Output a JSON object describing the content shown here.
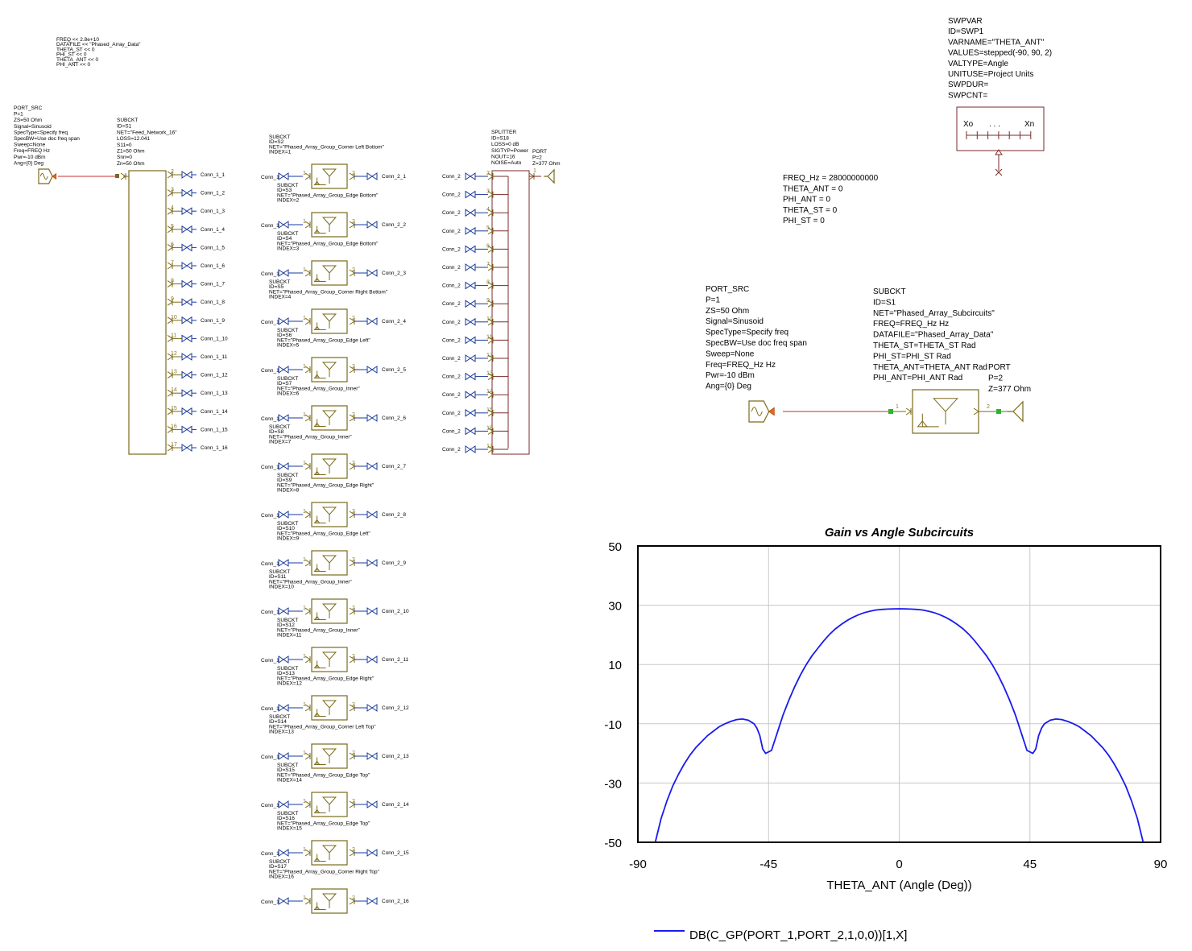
{
  "globals": {
    "lines": [
      "FREQ << 2.8e+10",
      "DATAFILE << \"Phased_Array_Data\"",
      "THETA_ST << 0",
      "PHI_ST << 0",
      "THETA_ANT << 0",
      "PHI_ANT << 0"
    ]
  },
  "port_src_small": {
    "lines": [
      "PORT_SRC",
      "P=1",
      "ZS=50 Ohm",
      "Signal=Sinusoid",
      "SpecType=Specify freq",
      "SpecBW=Use doc freq span",
      "Sweep=None",
      "Freq=FREQ Hz",
      "Pwr=-10 dBm",
      "Ang={0} Deg"
    ]
  },
  "feed_network": {
    "lines": [
      "SUBCKT",
      "ID=S1",
      "NET=\"Feed_Network_16\"",
      "LOSS=12.041",
      "S11=0",
      "Z1=50 Ohm",
      "Snn=0",
      "Zn=50 Ohm"
    ],
    "pins": [
      "2",
      "3",
      "4",
      "5",
      "6",
      "7",
      "8",
      "9",
      "10",
      "11",
      "12",
      "13",
      "14",
      "15",
      "16",
      "17"
    ],
    "conns": [
      "Conn_1_1",
      "Conn_1_2",
      "Conn_1_3",
      "Conn_1_4",
      "Conn_1_5",
      "Conn_1_6",
      "Conn_1_7",
      "Conn_1_8",
      "Conn_1_9",
      "Conn_1_10",
      "Conn_1_11",
      "Conn_1_12",
      "Conn_1_13",
      "Conn_1_14",
      "Conn_1_15",
      "Conn_1_16"
    ]
  },
  "groups": [
    {
      "id": "ID=S2",
      "net": "NET=\"Phased_Array_Group_Corner Left Bottom\"",
      "index": "INDEX=1",
      "in": "Conn_1",
      "out": "Conn_2_1"
    },
    {
      "id": "ID=S3",
      "net": "NET=\"Phased_Array_Group_Edge Bottom\"",
      "index": "INDEX=2",
      "in": "Conn_1",
      "out": "Conn_2_2"
    },
    {
      "id": "ID=S4",
      "net": "NET=\"Phased_Array_Group_Edge Bottom\"",
      "index": "INDEX=3",
      "in": "Conn_1",
      "out": "Conn_2_3"
    },
    {
      "id": "ID=S5",
      "net": "NET=\"Phased_Array_Group_Corner Right Bottom\"",
      "index": "INDEX=4",
      "in": "Conn_1",
      "out": "Conn_2_4"
    },
    {
      "id": "ID=S6",
      "net": "NET=\"Phased_Array_Group_Edge Left\"",
      "index": "INDEX=5",
      "in": "Conn_1",
      "out": "Conn_2_5"
    },
    {
      "id": "ID=S7",
      "net": "NET=\"Phased_Array_Group_Inner\"",
      "index": "INDEX=6",
      "in": "Conn_1",
      "out": "Conn_2_6"
    },
    {
      "id": "ID=S8",
      "net": "NET=\"Phased_Array_Group_Inner\"",
      "index": "INDEX=7",
      "in": "Conn_1",
      "out": "Conn_2_7"
    },
    {
      "id": "ID=S9",
      "net": "NET=\"Phased_Array_Group_Edge Right\"",
      "index": "INDEX=8",
      "in": "Conn_1",
      "out": "Conn_2_8"
    },
    {
      "id": "ID=S10",
      "net": "NET=\"Phased_Array_Group_Edge Left\"",
      "index": "INDEX=9",
      "in": "Conn_1",
      "out": "Conn_2_9"
    },
    {
      "id": "ID=S11",
      "net": "NET=\"Phased_Array_Group_Inner\"",
      "index": "INDEX=10",
      "in": "Conn_1",
      "out": "Conn_2_10"
    },
    {
      "id": "ID=S12",
      "net": "NET=\"Phased_Array_Group_Inner\"",
      "index": "INDEX=11",
      "in": "Conn_1",
      "out": "Conn_2_11"
    },
    {
      "id": "ID=S13",
      "net": "NET=\"Phased_Array_Group_Edge Right\"",
      "index": "INDEX=12",
      "in": "Conn_1",
      "out": "Conn_2_12"
    },
    {
      "id": "ID=S14",
      "net": "NET=\"Phased_Array_Group_Corner Left Top\"",
      "index": "INDEX=13",
      "in": "Conn_1",
      "out": "Conn_2_13"
    },
    {
      "id": "ID=S15",
      "net": "NET=\"Phased_Array_Group_Edge Top\"",
      "index": "INDEX=14",
      "in": "Conn_1",
      "out": "Conn_2_14"
    },
    {
      "id": "ID=S16",
      "net": "NET=\"Phased_Array_Group_Edge Top\"",
      "index": "INDEX=15",
      "in": "Conn_1",
      "out": "Conn_2_15"
    },
    {
      "id": "ID=S17",
      "net": "NET=\"Phased_Array_Group_Corner Right Top\"",
      "index": "INDEX=16",
      "in": "Conn_1",
      "out": "Conn_2_16"
    }
  ],
  "group_header": "SUBCKT",
  "splitter": {
    "lines": [
      "SPLITTER",
      "ID=S18",
      "LOSS=0 dB",
      "SIGTYP=Power",
      "NOUT=16",
      "NOISE=Auto"
    ],
    "conn_label": "Conn_2",
    "pins": [
      "2",
      "3",
      "4",
      "5",
      "6",
      "7",
      "8",
      "9",
      "10",
      "11",
      "12",
      "13",
      "14",
      "15",
      "16",
      "17"
    ]
  },
  "port_small": {
    "lines": [
      "PORT",
      "P=2",
      "Z=377 Ohm"
    ],
    "pin": "1"
  },
  "swpvar": {
    "lines": [
      "SWPVAR",
      "ID=SWP1",
      "VARNAME=\"THETA_ANT\"",
      "VALUES=stepped(-90, 90, 2)",
      "VALTYPE=Angle",
      "UNITUSE=Project Units",
      "SWPDUR=",
      "SWPCNT="
    ],
    "xo": "Xo",
    "dots": ". . .",
    "xn": "Xn"
  },
  "equations": [
    "FREQ_Hz = 28000000000",
    "THETA_ANT = 0",
    "PHI_ANT = 0",
    "THETA_ST = 0",
    "PHI_ST = 0"
  ],
  "port_src_big": {
    "lines": [
      "PORT_SRC",
      "P=1",
      "ZS=50 Ohm",
      "Signal=Sinusoid",
      "SpecType=Specify freq",
      "SpecBW=Use doc freq span",
      "Sweep=None",
      "Freq=FREQ_Hz Hz",
      "Pwr=-10 dBm",
      "Ang={0} Deg"
    ]
  },
  "subckt_big": {
    "lines": [
      "SUBCKT",
      "ID=S1",
      "NET=\"Phased_Array_Subcircuits\"",
      "FREQ=FREQ_Hz Hz",
      "DATAFILE=\"Phased_Array_Data\"",
      "THETA_ST=THETA_ST Rad",
      "PHI_ST=PHI_ST Rad",
      "THETA_ANT=THETA_ANT Rad",
      "PHI_ANT=PHI_ANT Rad"
    ],
    "pin1": "1",
    "pin2": "2"
  },
  "port_big": {
    "lines": [
      "PORT",
      "P=2",
      "Z=377 Ohm"
    ]
  },
  "colors": {
    "component": "#7a6a1a",
    "connector": "#1a3a9a",
    "wire_red": "#c03030",
    "trace": "#1a1aee"
  },
  "chart_data": {
    "type": "line",
    "title": "Gain vs Angle Subcircuits",
    "xlabel": "THETA_ANT (Angle (Deg))",
    "ylabel": "",
    "xlim": [
      -90,
      90
    ],
    "ylim": [
      -50,
      50
    ],
    "xticks": [
      -90,
      -45,
      0,
      45,
      90
    ],
    "yticks": [
      50,
      30,
      10,
      -10,
      -30,
      -50
    ],
    "grid": true,
    "legend": "bottom",
    "series": [
      {
        "name": "DB(C_GP(PORT_1,PORT_2,1,0,0))[1,X]",
        "color": "#1a1aee",
        "x": [
          -84,
          -82,
          -80,
          -78,
          -76,
          -74,
          -72,
          -70,
          -68,
          -66,
          -64,
          -62,
          -60,
          -58,
          -56,
          -54,
          -52,
          -50,
          -49,
          -48,
          -47,
          -46,
          -44,
          -42,
          -40,
          -38,
          -36,
          -34,
          -32,
          -30,
          -28,
          -26,
          -24,
          -22,
          -20,
          -18,
          -16,
          -14,
          -12,
          -10,
          -8,
          -6,
          -4,
          -2,
          0,
          2,
          4,
          6,
          8,
          10,
          12,
          14,
          16,
          18,
          20,
          22,
          24,
          26,
          28,
          30,
          32,
          34,
          36,
          38,
          40,
          42,
          44,
          46,
          47,
          48,
          49,
          50,
          52,
          54,
          56,
          58,
          60,
          62,
          64,
          66,
          68,
          70,
          72,
          74,
          76,
          78,
          80,
          82,
          84
        ],
        "y": [
          -50,
          -42,
          -36,
          -31,
          -27,
          -23.5,
          -20.5,
          -18,
          -16,
          -14,
          -12.5,
          -11,
          -10,
          -9.2,
          -8.6,
          -8.4,
          -8.8,
          -10,
          -11.5,
          -14,
          -18.5,
          -20,
          -19,
          -13,
          -7,
          -2,
          2.5,
          6.5,
          10,
          13,
          15.5,
          18,
          20.2,
          22,
          23.5,
          24.8,
          25.9,
          26.8,
          27.5,
          28.0,
          28.4,
          28.6,
          28.7,
          28.75,
          28.8,
          28.75,
          28.7,
          28.6,
          28.4,
          28.0,
          27.5,
          26.8,
          25.9,
          24.8,
          23.5,
          22,
          20.2,
          18,
          15.5,
          13,
          10,
          6.5,
          2.5,
          -2,
          -7,
          -13,
          -19,
          -20,
          -18.5,
          -14,
          -11.5,
          -10,
          -8.8,
          -8.4,
          -8.6,
          -9.2,
          -10,
          -11,
          -12.5,
          -14,
          -16,
          -18,
          -20.5,
          -23.5,
          -27,
          -31,
          -36,
          -42,
          -50
        ]
      }
    ]
  }
}
